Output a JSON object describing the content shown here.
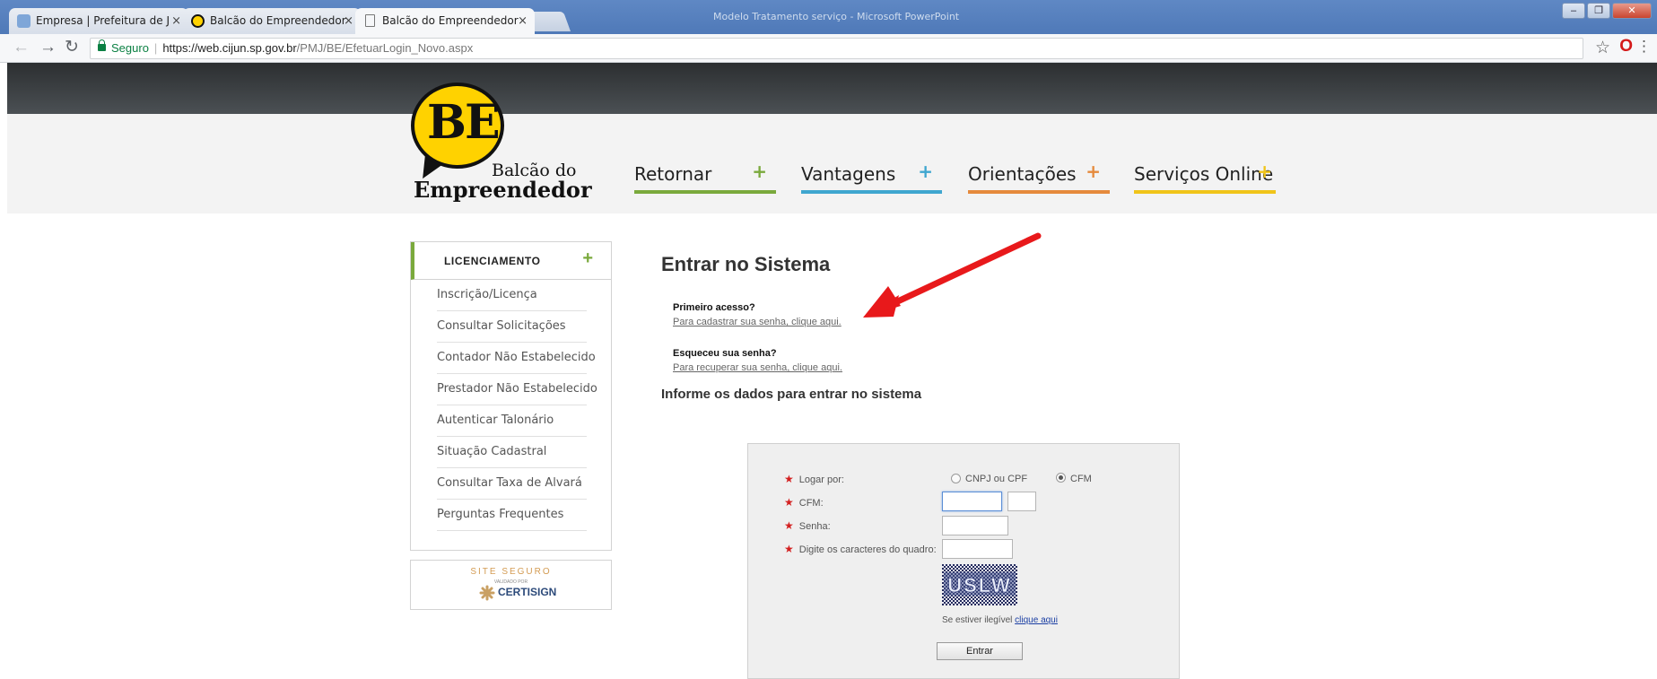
{
  "browser": {
    "tabs": [
      {
        "title": "Empresa | Prefeitura de J",
        "icon": "page-icon"
      },
      {
        "title": "Balcão do Empreendedor",
        "icon": "be-logo-icon"
      },
      {
        "title": "Balcão do Empreendedor",
        "icon": "document-icon"
      }
    ],
    "window_title": "Modelo Tratamento serviço - Microsoft PowerPoint",
    "security_label": "Seguro",
    "url_host": "https://web.cijun.sp.gov.br",
    "url_path": "/PMJ/BE/EfetuarLogin_Novo.aspx"
  },
  "logo": {
    "letters": "BE",
    "line1": "Balcão do",
    "line2": "Empreendedor"
  },
  "nav": [
    {
      "label": "Retornar",
      "color": "#7aa93c"
    },
    {
      "label": "Vantagens",
      "color": "#3fa6cf"
    },
    {
      "label": "Orientações",
      "color": "#e58a3c"
    },
    {
      "label": "Serviços Online",
      "color": "#f0c419"
    }
  ],
  "sidebar": {
    "heading": "LICENCIAMENTO",
    "items": [
      "Inscrição/Licença",
      "Consultar Solicitações",
      "Contador Não Estabelecido",
      "Prestador Não Estabelecido",
      "Autenticar Talonário",
      "Situação Cadastral",
      "Consultar Taxa de Alvará",
      "Perguntas Frequentes"
    ]
  },
  "seal": {
    "title": "SITE SEGURO",
    "subtitle": "VALIDADO POR",
    "brand": "CERTISIGN"
  },
  "main": {
    "title": "Entrar no Sistema",
    "first_access_heading": "Primeiro acesso?",
    "first_access_link": "Para cadastrar sua senha, clique aqui.",
    "forgot_heading": "Esqueceu sua senha?",
    "forgot_link": "Para recuperar sua senha, clique aqui.",
    "subtitle": "Informe os dados para entrar no sistema"
  },
  "form": {
    "login_by_label": "Logar por:",
    "option_cnpj": "CNPJ ou CPF",
    "option_cfm": "CFM",
    "selected_option": "CFM",
    "cfm_label": "CFM:",
    "password_label": "Senha:",
    "captcha_label": "Digite os caracteres do quadro:",
    "captcha_text": "USLW",
    "illegible_text": "Se estiver ilegível",
    "illegible_link": "clique aqui",
    "submit_label": "Entrar"
  },
  "colors": {
    "accent_green": "#7aa93c",
    "logo_yellow": "#ffd200",
    "annotation_arrow": "#e8191b"
  }
}
